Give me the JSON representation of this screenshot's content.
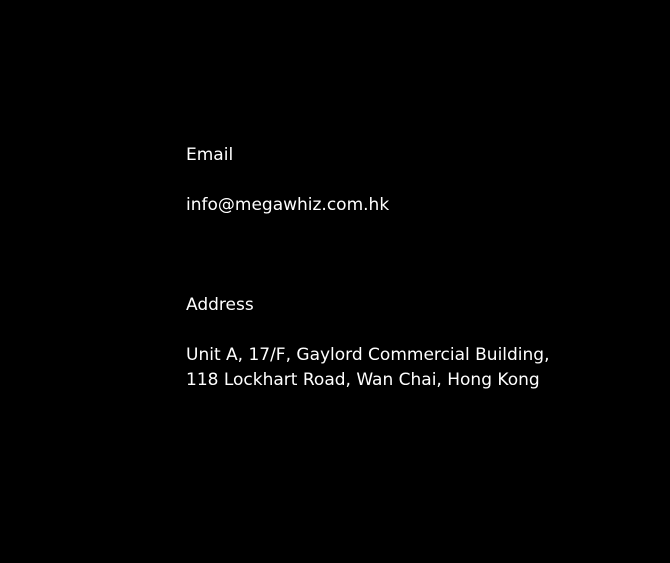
{
  "contact": {
    "email_label": "Email",
    "email_value": "info@megawhiz.com.hk",
    "address_label": "Address",
    "address_lines": [
      "Unit A, 17/F, Gaylord Commercial Building,",
      "118 Lockhart Road, Wan Chai, Hong Kong"
    ]
  },
  "colors": {
    "background": "#000000",
    "text": "#ffffff"
  }
}
